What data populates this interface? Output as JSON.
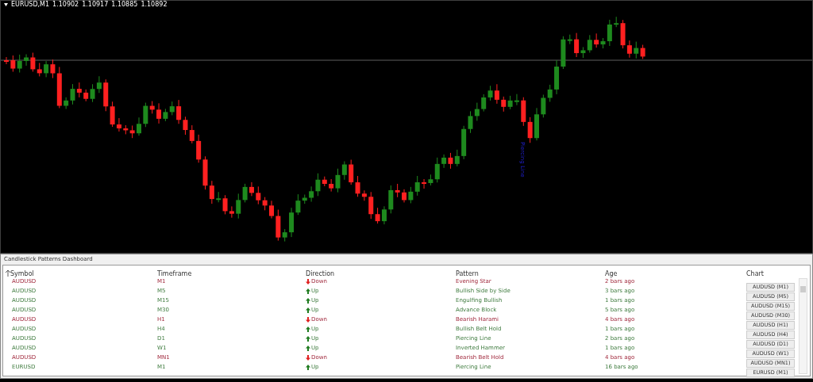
{
  "chart": {
    "symbol": "EURUSD,M1",
    "prices": [
      "1.10902",
      "1.10917",
      "1.10885",
      "1.10892"
    ],
    "annotation": "Piercing Line"
  },
  "dashboard": {
    "title": "Candlestick Patterns Dashboard",
    "columns": [
      "Symbol",
      "Timeframe",
      "Direction",
      "Pattern",
      "Age",
      "Chart"
    ],
    "rows": [
      {
        "symbol": "AUDUSD",
        "timeframe": "M1",
        "kind": "down",
        "direction_label": "Down",
        "pattern": "Evening Star",
        "age": "2 bars ago",
        "chart": "AUDUSD (M1)"
      },
      {
        "symbol": "AUDUSD",
        "timeframe": "M5",
        "kind": "up",
        "direction_label": "Up",
        "pattern": "Bullish Side by Side",
        "age": "3 bars ago",
        "chart": "AUDUSD (M5)"
      },
      {
        "symbol": "AUDUSD",
        "timeframe": "M15",
        "kind": "up",
        "direction_label": "Up",
        "pattern": "Engulfing Bullish",
        "age": "1 bars ago",
        "chart": "AUDUSD (M15)"
      },
      {
        "symbol": "AUDUSD",
        "timeframe": "M30",
        "kind": "up",
        "direction_label": "Up",
        "pattern": "Advance Block",
        "age": "5 bars ago",
        "chart": "AUDUSD (M30)"
      },
      {
        "symbol": "AUDUSD",
        "timeframe": "H1",
        "kind": "down",
        "direction_label": "Down",
        "pattern": "Bearish Harami",
        "age": "4 bars ago",
        "chart": "AUDUSD (H1)"
      },
      {
        "symbol": "AUDUSD",
        "timeframe": "H4",
        "kind": "up",
        "direction_label": "Up",
        "pattern": "Bullish Belt Hold",
        "age": "1 bars ago",
        "chart": "AUDUSD (H4)"
      },
      {
        "symbol": "AUDUSD",
        "timeframe": "D1",
        "kind": "up",
        "direction_label": "Up",
        "pattern": "Piercing Line",
        "age": "2 bars ago",
        "chart": "AUDUSD (D1)"
      },
      {
        "symbol": "AUDUSD",
        "timeframe": "W1",
        "kind": "up",
        "direction_label": "Up",
        "pattern": "Inverted Hammer",
        "age": "1 bars ago",
        "chart": "AUDUSD (W1)"
      },
      {
        "symbol": "AUDUSD",
        "timeframe": "MN1",
        "kind": "down",
        "direction_label": "Down",
        "pattern": "Bearish Belt Hold",
        "age": "4 bars ago",
        "chart": "AUDUSD (MN1)"
      },
      {
        "symbol": "EURUSD",
        "timeframe": "M1",
        "kind": "up",
        "direction_label": "Up",
        "pattern": "Piercing Line",
        "age": "16 bars ago",
        "chart": "EURUSD (M1)"
      }
    ]
  }
}
